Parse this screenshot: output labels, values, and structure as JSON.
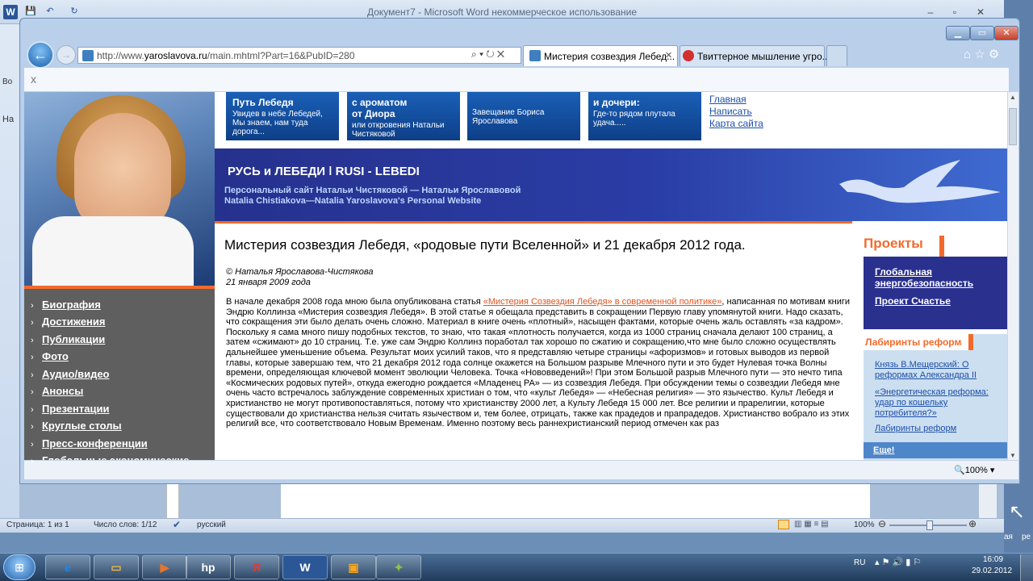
{
  "word": {
    "title": "Документ7 - Microsoft Word некоммерческое использование",
    "app_letter": "W",
    "left_lbl1": "Во",
    "left_lbl2": "На",
    "status": {
      "page": "Страница: 1 из 1",
      "words": "Число слов: 1/12",
      "language": "русский",
      "zoom": "100%",
      "zoom_level_percent": 100
    }
  },
  "ie": {
    "address_prefix": "http://www.",
    "address_domain": "yaroslavova.ru",
    "address_suffix": "/main.mhtml?Part=16&PubID=280",
    "tabs": [
      {
        "label": "Мистерия созвездия Лебед..."
      },
      {
        "label": "Твиттерное мышление угро..."
      }
    ],
    "zoom": "100%",
    "close_cmd": "x"
  },
  "site": {
    "promos": [
      {
        "title": "Путь Лебедя",
        "title2": "",
        "text": "Увидев в небе Лебедей, Мы знаем, нам туда дорога..."
      },
      {
        "title": "с ароматом",
        "title2": "от Диора",
        "text": "или откровения Натальи Чистяковой"
      },
      {
        "title": "",
        "title2": "",
        "text": "Завещание Бориса Ярославова"
      },
      {
        "title": "и дочери:",
        "title2": "",
        "text": "Где-то рядом плутала удача....."
      }
    ],
    "top_links": [
      "Главная",
      "Написать",
      "Карта сайта"
    ],
    "banner": {
      "title": "РУСЬ и ЛЕБЕДИ ǀ RUSI - LEBEDI",
      "sub1": "Персональный сайт Натальи Чистяковой — Натальи Ярославовой",
      "sub2": "Natalia Chistiakova—Natalia Yaroslavova's  Personal Website"
    },
    "nav": [
      "Биография",
      "Достижения",
      "Публикации",
      "Фото",
      "Аудио/видео",
      "Анонсы",
      "Презентации",
      "Круглые столы",
      "Пресс-конференции",
      "Глобальные экономические"
    ],
    "article": {
      "title": "Мистерия созвездия Лебедя, «родовые пути Вселенной» и 21 декабря 2012 года.",
      "author": "© Наталья Ярославова-Чистякова",
      "date": "21 января 2009 года",
      "intro": "В начале декабря 2008 года мною была опубликована статья ",
      "link": "«Мистерия Созвездия Лебедя» в современной политике»",
      "body": ", написанная по мотивам книги Эндрю Коллинза «Мистерия созвездия Лебедя». В этой статье я обещала представить в сокращении Первую главу упомянутой книги. Надо сказать, что сокращения эти было делать очень сложно. Материал в книге очень «плотный», насыщен фактами, которые очень жаль оставлять «за кадром». Поскольку я сама много пишу подобных текстов, то знаю, что такая «плотность получается, когда из 1000 страниц сначала делают 100 страниц, а затем «сжимают» до 10 страниц. Т.е. уже сам Эндрю Коллинз поработал так хорошо по сжатию и сокращению,что мне было сложно осуществлять дальнейшее уменьшение объема. Результат моих усилий таков, что я представляю четыре страницы «афоризмов» и готовых выводов из первой главы, которые завершаю тем, что 21 декабря 2012 года солнце окажется на Большом разрыве Млечного пути и это будет Нулевая точка Волны времени, определяющая ключевой момент эволюции Человека. Точка «Нововведений»! При этом Большой разрыв Млечного пути — это нечто типа «Космических родовых путей», откуда ежегодно рождается «Младенец РА» — из созвездия Лебедя. При обсуждении темы о созвездии Лебедя мне очень часто встречалось заблуждение современных христиан о том, что «культ Лебедя» — «Небесная религия» — это язычество. Культ Лебедя и христианство не могут противопоставляться, потому что христианству 2000 лет, а Культу Лебедя 15 000 лет. Все религии и прарелигии, которые существовали до христианства нельзя считать язычеством и, тем более, отрицать, также как прадедов и прапрадедов. Христианство вобрало из этих религий все, что соответствовало Новым Временам. Именно поэтому весь раннехристианский период отмечен как раз"
    },
    "projects": {
      "header": "Проекты",
      "link1": "Глобальная энергобезопасность",
      "link2": "Проект Счастье"
    },
    "labyrinths": {
      "header": "Лабиринты реформ",
      "links": [
        "Князь В.Мещерский: О реформах Александра II",
        "«Энергетическая реформа: удар по кошельку потребителя?»",
        "Лабиринты реформ"
      ],
      "more": "Еще!"
    }
  },
  "taskbar": {
    "yandex": "Я",
    "word": "W",
    "hp": "hp"
  },
  "tray": {
    "lang": "RU",
    "time": "16:09",
    "date": "29.02.2012",
    "side1": "ая",
    "side2": "ре"
  },
  "colors": {
    "accent_orange": "#f26a2b",
    "banner_blue": "#2a3da6",
    "nav_gray": "#5f5f5f"
  }
}
